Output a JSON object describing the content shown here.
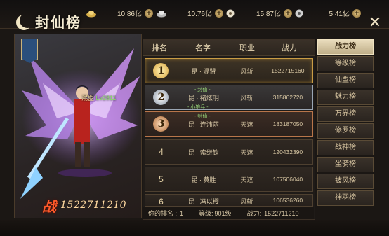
{
  "header": {
    "title": "封仙榜",
    "close_icon": "close-icon",
    "resources": [
      {
        "icon": "gold-ingot-icon",
        "value": "10.86亿"
      },
      {
        "icon": "silver-ingot-icon",
        "value": "10.76亿"
      },
      {
        "icon": "coin-icon",
        "value": "15.87亿"
      },
      {
        "icon": "silver-coin-icon",
        "value": "5.41亿"
      }
    ]
  },
  "hero": {
    "guild": "混盟",
    "guild_level": "Lv2811",
    "power_glyph": "战",
    "power_value": "1522711210"
  },
  "table": {
    "headers": {
      "rank": "排名",
      "name": "名字",
      "job": "职业",
      "power": "战力"
    },
    "rows": [
      {
        "rank": "1",
        "name": "昆 · 混盟",
        "job": "风斩",
        "power": "1522715160"
      },
      {
        "rank": "2",
        "name": "昆 · 褚炫明",
        "job": "风斩",
        "power": "315862720",
        "tag_top": "- 封仙 -",
        "tag_bottom": "- 小狼兵 -"
      },
      {
        "rank": "3",
        "name": "昆 · 连沛菡",
        "job": "天遮",
        "power": "183187050",
        "tag_top": "- 封仙 -"
      },
      {
        "rank": "4",
        "name": "昆 · 索继钦",
        "job": "天遮",
        "power": "120432390"
      },
      {
        "rank": "5",
        "name": "昆 · 黄胜",
        "job": "天遮",
        "power": "107506040"
      },
      {
        "rank": "6",
        "name": "昆 · 冯以樱",
        "job": "风斩",
        "power": "106536260"
      }
    ]
  },
  "footer": {
    "my_rank_label": "你的排名 :",
    "my_rank_value": "1",
    "level_label": "等级:",
    "level_value": "901级",
    "power_label": "战力:",
    "power_value": "1522711210"
  },
  "tabs": [
    "战力榜",
    "等级榜",
    "仙盟榜",
    "魅力榜",
    "万界榜",
    "修罗榜",
    "战神榜",
    "坐骑榜",
    "披风榜",
    "神羽榜"
  ],
  "active_tab": "战力榜"
}
